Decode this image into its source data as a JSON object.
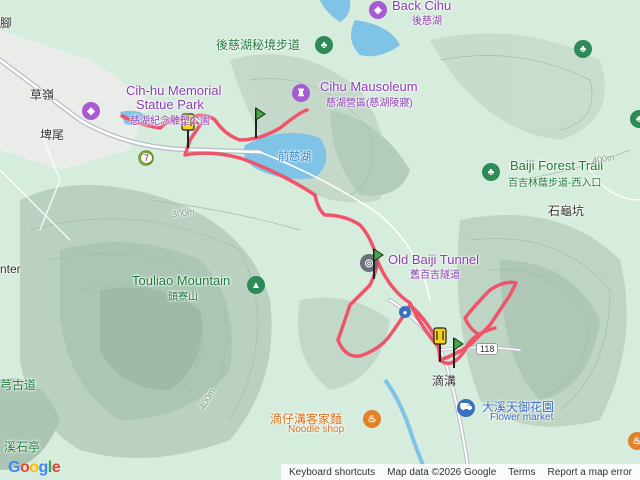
{
  "colors": {
    "route": "#f0546a",
    "green_poi": "#1e7a3c",
    "purple_poi": "#8a3fb3",
    "orange_poi": "#d9711a",
    "blue_poi": "#3a6fbf",
    "water": "#7fc3e6",
    "road": "#b8bcc4",
    "marker_yellow": "#f4d21b",
    "marker_green": "#3fae3f"
  },
  "labels": {
    "back_cihu_en": "Back Cihu",
    "back_cihu_zh": "後慈湖",
    "houcihu_trail": "後慈湖秘境步道",
    "cihu_memorial_en1": "Cih-hu Memorial",
    "cihu_memorial_en2": "Statue Park",
    "cihu_memorial_zh": "慈湖紀念雕塑公園",
    "cihu_mausoleum_en": "Cihu Mausoleum",
    "cihu_mausoleum_zh": "慈湖營區(慈湖陵寢)",
    "qian_cihu": "前慈湖",
    "caoling": "草嶺",
    "beiwei": "埤尾",
    "jiao": "腳",
    "baiji_trail_en": "Baiji Forest Trail",
    "baiji_trail_zh": "百吉林蔭步道-西入口",
    "shiguikeng": "石龜坑",
    "old_baiji_tunnel_en": "Old Baiji Tunnel",
    "old_baiji_tunnel_zh": "舊百吉隧道",
    "touliao_mountain_en": "Touliao Mountain",
    "touliao_mountain_zh": "頭寮山",
    "dikeng": "滴溝",
    "daxi_garden_zh": "大溪天御花園",
    "daxi_garden_en": "Flower market",
    "noodle_zh": "滴仔溝客家麵",
    "noodle_en": "Noodle shop",
    "center_partial": "nter",
    "sancha_partial": "芎古道",
    "xishi_partial": "溪石亭",
    "elev_300m": "300m",
    "elev_400m": "400m",
    "elev_400m_b": "400m",
    "route_7": "7",
    "route_118": "118"
  },
  "attribution": {
    "keyboard": "Keyboard shortcuts",
    "map_data": "Map data ©2026 Google",
    "terms": "Terms",
    "report": "Report a map error"
  },
  "logo": "Google"
}
